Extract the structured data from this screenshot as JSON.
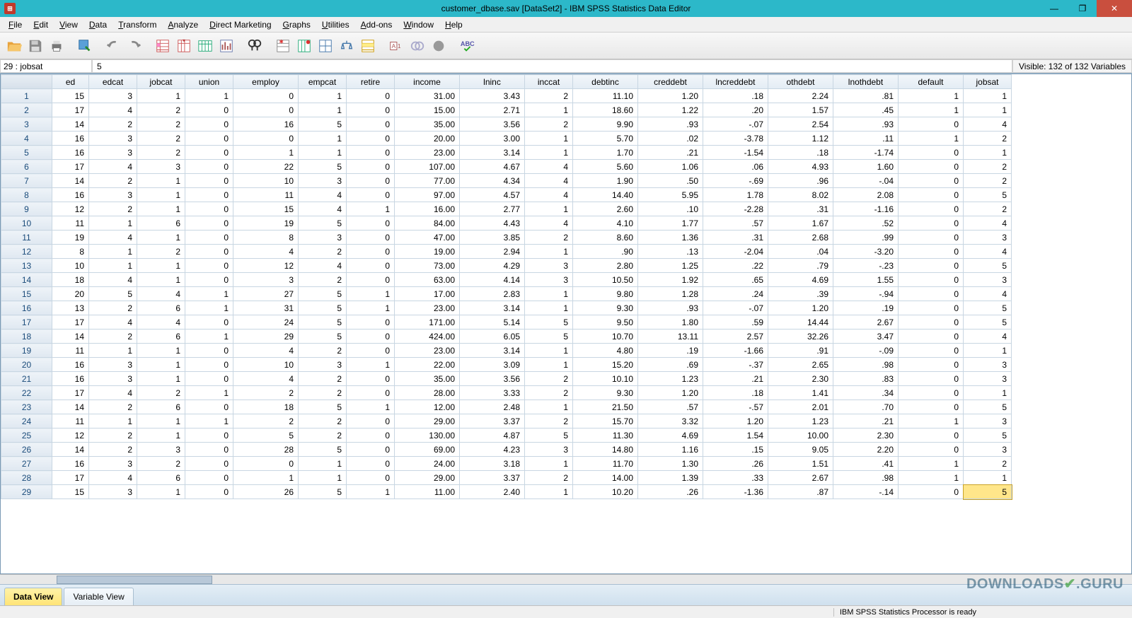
{
  "window": {
    "title": "customer_dbase.sav [DataSet2] - IBM SPSS Statistics Data Editor"
  },
  "menu": [
    "File",
    "Edit",
    "View",
    "Data",
    "Transform",
    "Analyze",
    "Direct Marketing",
    "Graphs",
    "Utilities",
    "Add-ons",
    "Window",
    "Help"
  ],
  "info": {
    "cell_address": "29 : jobsat",
    "cell_value": "5",
    "visible_label": "Visible: 132 of 132 Variables"
  },
  "columns": [
    "ed",
    "edcat",
    "jobcat",
    "union",
    "employ",
    "empcat",
    "retire",
    "income",
    "lninc",
    "inccat",
    "debtinc",
    "creddebt",
    "lncreddebt",
    "othdebt",
    "lnothdebt",
    "default",
    "jobsat"
  ],
  "rows": [
    [
      15,
      3,
      1,
      1,
      0,
      1,
      0,
      "31.00",
      "3.43",
      2,
      "11.10",
      "1.20",
      ".18",
      "2.24",
      ".81",
      1,
      1
    ],
    [
      17,
      4,
      2,
      0,
      0,
      1,
      0,
      "15.00",
      "2.71",
      1,
      "18.60",
      "1.22",
      ".20",
      "1.57",
      ".45",
      1,
      1
    ],
    [
      14,
      2,
      2,
      0,
      16,
      5,
      0,
      "35.00",
      "3.56",
      2,
      "9.90",
      ".93",
      "-.07",
      "2.54",
      ".93",
      0,
      4
    ],
    [
      16,
      3,
      2,
      0,
      0,
      1,
      0,
      "20.00",
      "3.00",
      1,
      "5.70",
      ".02",
      "-3.78",
      "1.12",
      ".11",
      1,
      2
    ],
    [
      16,
      3,
      2,
      0,
      1,
      1,
      0,
      "23.00",
      "3.14",
      1,
      "1.70",
      ".21",
      "-1.54",
      ".18",
      "-1.74",
      0,
      1
    ],
    [
      17,
      4,
      3,
      0,
      22,
      5,
      0,
      "107.00",
      "4.67",
      4,
      "5.60",
      "1.06",
      ".06",
      "4.93",
      "1.60",
      0,
      2
    ],
    [
      14,
      2,
      1,
      0,
      10,
      3,
      0,
      "77.00",
      "4.34",
      4,
      "1.90",
      ".50",
      "-.69",
      ".96",
      "-.04",
      0,
      2
    ],
    [
      16,
      3,
      1,
      0,
      11,
      4,
      0,
      "97.00",
      "4.57",
      4,
      "14.40",
      "5.95",
      "1.78",
      "8.02",
      "2.08",
      0,
      5
    ],
    [
      12,
      2,
      1,
      0,
      15,
      4,
      1,
      "16.00",
      "2.77",
      1,
      "2.60",
      ".10",
      "-2.28",
      ".31",
      "-1.16",
      0,
      2
    ],
    [
      11,
      1,
      6,
      0,
      19,
      5,
      0,
      "84.00",
      "4.43",
      4,
      "4.10",
      "1.77",
      ".57",
      "1.67",
      ".52",
      0,
      4
    ],
    [
      19,
      4,
      1,
      0,
      8,
      3,
      0,
      "47.00",
      "3.85",
      2,
      "8.60",
      "1.36",
      ".31",
      "2.68",
      ".99",
      0,
      3
    ],
    [
      8,
      1,
      2,
      0,
      4,
      2,
      0,
      "19.00",
      "2.94",
      1,
      ".90",
      ".13",
      "-2.04",
      ".04",
      "-3.20",
      0,
      4
    ],
    [
      10,
      1,
      1,
      0,
      12,
      4,
      0,
      "73.00",
      "4.29",
      3,
      "2.80",
      "1.25",
      ".22",
      ".79",
      "-.23",
      0,
      5
    ],
    [
      18,
      4,
      1,
      0,
      3,
      2,
      0,
      "63.00",
      "4.14",
      3,
      "10.50",
      "1.92",
      ".65",
      "4.69",
      "1.55",
      0,
      3
    ],
    [
      20,
      5,
      4,
      1,
      27,
      5,
      1,
      "17.00",
      "2.83",
      1,
      "9.80",
      "1.28",
      ".24",
      ".39",
      "-.94",
      0,
      4
    ],
    [
      13,
      2,
      6,
      1,
      31,
      5,
      1,
      "23.00",
      "3.14",
      1,
      "9.30",
      ".93",
      "-.07",
      "1.20",
      ".19",
      0,
      5
    ],
    [
      17,
      4,
      4,
      0,
      24,
      5,
      0,
      "171.00",
      "5.14",
      5,
      "9.50",
      "1.80",
      ".59",
      "14.44",
      "2.67",
      0,
      5
    ],
    [
      14,
      2,
      6,
      1,
      29,
      5,
      0,
      "424.00",
      "6.05",
      5,
      "10.70",
      "13.11",
      "2.57",
      "32.26",
      "3.47",
      0,
      4
    ],
    [
      11,
      1,
      1,
      0,
      4,
      2,
      0,
      "23.00",
      "3.14",
      1,
      "4.80",
      ".19",
      "-1.66",
      ".91",
      "-.09",
      0,
      1
    ],
    [
      16,
      3,
      1,
      0,
      10,
      3,
      1,
      "22.00",
      "3.09",
      1,
      "15.20",
      ".69",
      "-.37",
      "2.65",
      ".98",
      0,
      3
    ],
    [
      16,
      3,
      1,
      0,
      4,
      2,
      0,
      "35.00",
      "3.56",
      2,
      "10.10",
      "1.23",
      ".21",
      "2.30",
      ".83",
      0,
      3
    ],
    [
      17,
      4,
      2,
      1,
      2,
      2,
      0,
      "28.00",
      "3.33",
      2,
      "9.30",
      "1.20",
      ".18",
      "1.41",
      ".34",
      0,
      1
    ],
    [
      14,
      2,
      6,
      0,
      18,
      5,
      1,
      "12.00",
      "2.48",
      1,
      "21.50",
      ".57",
      "-.57",
      "2.01",
      ".70",
      0,
      5
    ],
    [
      11,
      1,
      1,
      1,
      2,
      2,
      0,
      "29.00",
      "3.37",
      2,
      "15.70",
      "3.32",
      "1.20",
      "1.23",
      ".21",
      1,
      3
    ],
    [
      12,
      2,
      1,
      0,
      5,
      2,
      0,
      "130.00",
      "4.87",
      5,
      "11.30",
      "4.69",
      "1.54",
      "10.00",
      "2.30",
      0,
      5
    ],
    [
      14,
      2,
      3,
      0,
      28,
      5,
      0,
      "69.00",
      "4.23",
      3,
      "14.80",
      "1.16",
      ".15",
      "9.05",
      "2.20",
      0,
      3
    ],
    [
      16,
      3,
      2,
      0,
      0,
      1,
      0,
      "24.00",
      "3.18",
      1,
      "11.70",
      "1.30",
      ".26",
      "1.51",
      ".41",
      1,
      2
    ],
    [
      17,
      4,
      6,
      0,
      1,
      1,
      0,
      "29.00",
      "3.37",
      2,
      "14.00",
      "1.39",
      ".33",
      "2.67",
      ".98",
      1,
      1
    ],
    [
      15,
      3,
      1,
      0,
      26,
      5,
      1,
      "11.00",
      "2.40",
      1,
      "10.20",
      ".26",
      "-1.36",
      ".87",
      "-.14",
      0,
      5
    ]
  ],
  "tabs": {
    "data_view": "Data View",
    "variable_view": "Variable View"
  },
  "status": {
    "processor": "IBM SPSS Statistics Processor is ready"
  },
  "watermark": {
    "t1": "DOWNLOADS",
    "t2": ".GURU"
  },
  "active_cell": {
    "row": 29,
    "col": 16
  }
}
